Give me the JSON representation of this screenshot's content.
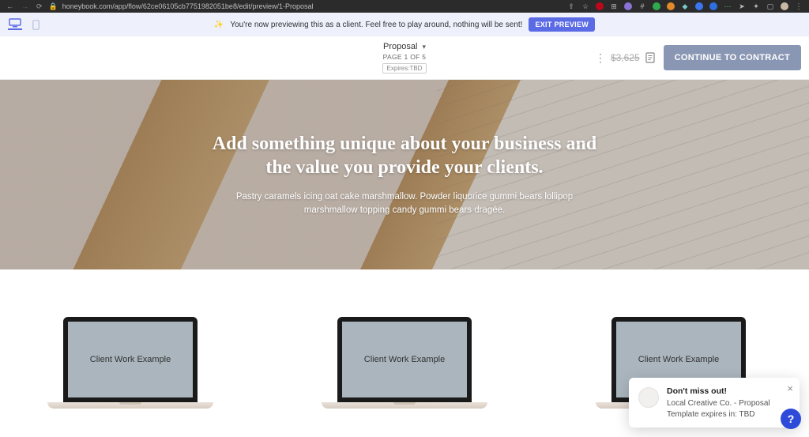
{
  "browser": {
    "url": "honeybook.com/app/flow/62ce06105cb7751982051be8/edit/preview/1-Proposal"
  },
  "banner": {
    "message": "You're now previewing this as a client. Feel free to play around, nothing will be sent!",
    "exit_label": "EXIT PREVIEW"
  },
  "toolbar": {
    "title": "Proposal",
    "page_info": "PAGE 1 OF 5",
    "expires": "Expires:TBD",
    "price": "$3,625",
    "cta": "CONTINUE TO CONTRACT"
  },
  "hero": {
    "heading": "Add something unique about your business and the value you provide your clients.",
    "subtext": "Pastry caramels icing oat cake marshmallow. Powder liquorice gummi bears lollipop marshmallow topping candy gummi bears dragée."
  },
  "portfolio": {
    "items": [
      {
        "label": "Client Work Example"
      },
      {
        "label": "Client Work Example"
      },
      {
        "label": "Client Work Example"
      }
    ]
  },
  "toast": {
    "title": "Don't miss out!",
    "body": "Local Creative Co. - Proposal Template expires in: TBD"
  }
}
